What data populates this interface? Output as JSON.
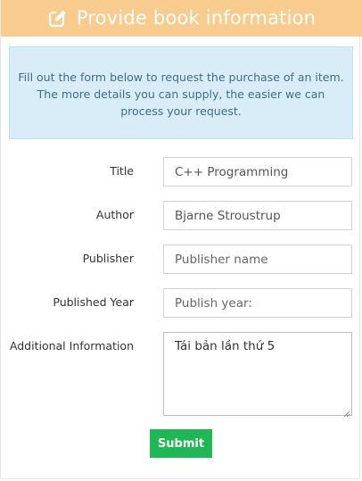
{
  "header": {
    "title": "Provide book information",
    "icon": "edit-icon",
    "background_color": "#f8cb8e"
  },
  "info": {
    "line1": "Fill out the form below to request the purchase of an item.",
    "line2": "The more details you can supply, the easier we can",
    "line3": "process your request."
  },
  "form": {
    "title": {
      "label": "Title",
      "value": "C++ Programming"
    },
    "author": {
      "label": "Author",
      "value": "Bjarne Stroustrup"
    },
    "publisher": {
      "label": "Publisher",
      "placeholder": "Publisher name"
    },
    "year": {
      "label": "Published Year",
      "placeholder": "Publish year:"
    },
    "additional": {
      "label": "Additional Information",
      "value": "Tái bản lần thứ 5"
    },
    "submit_label": "Submit",
    "submit_color": "#20b757"
  }
}
